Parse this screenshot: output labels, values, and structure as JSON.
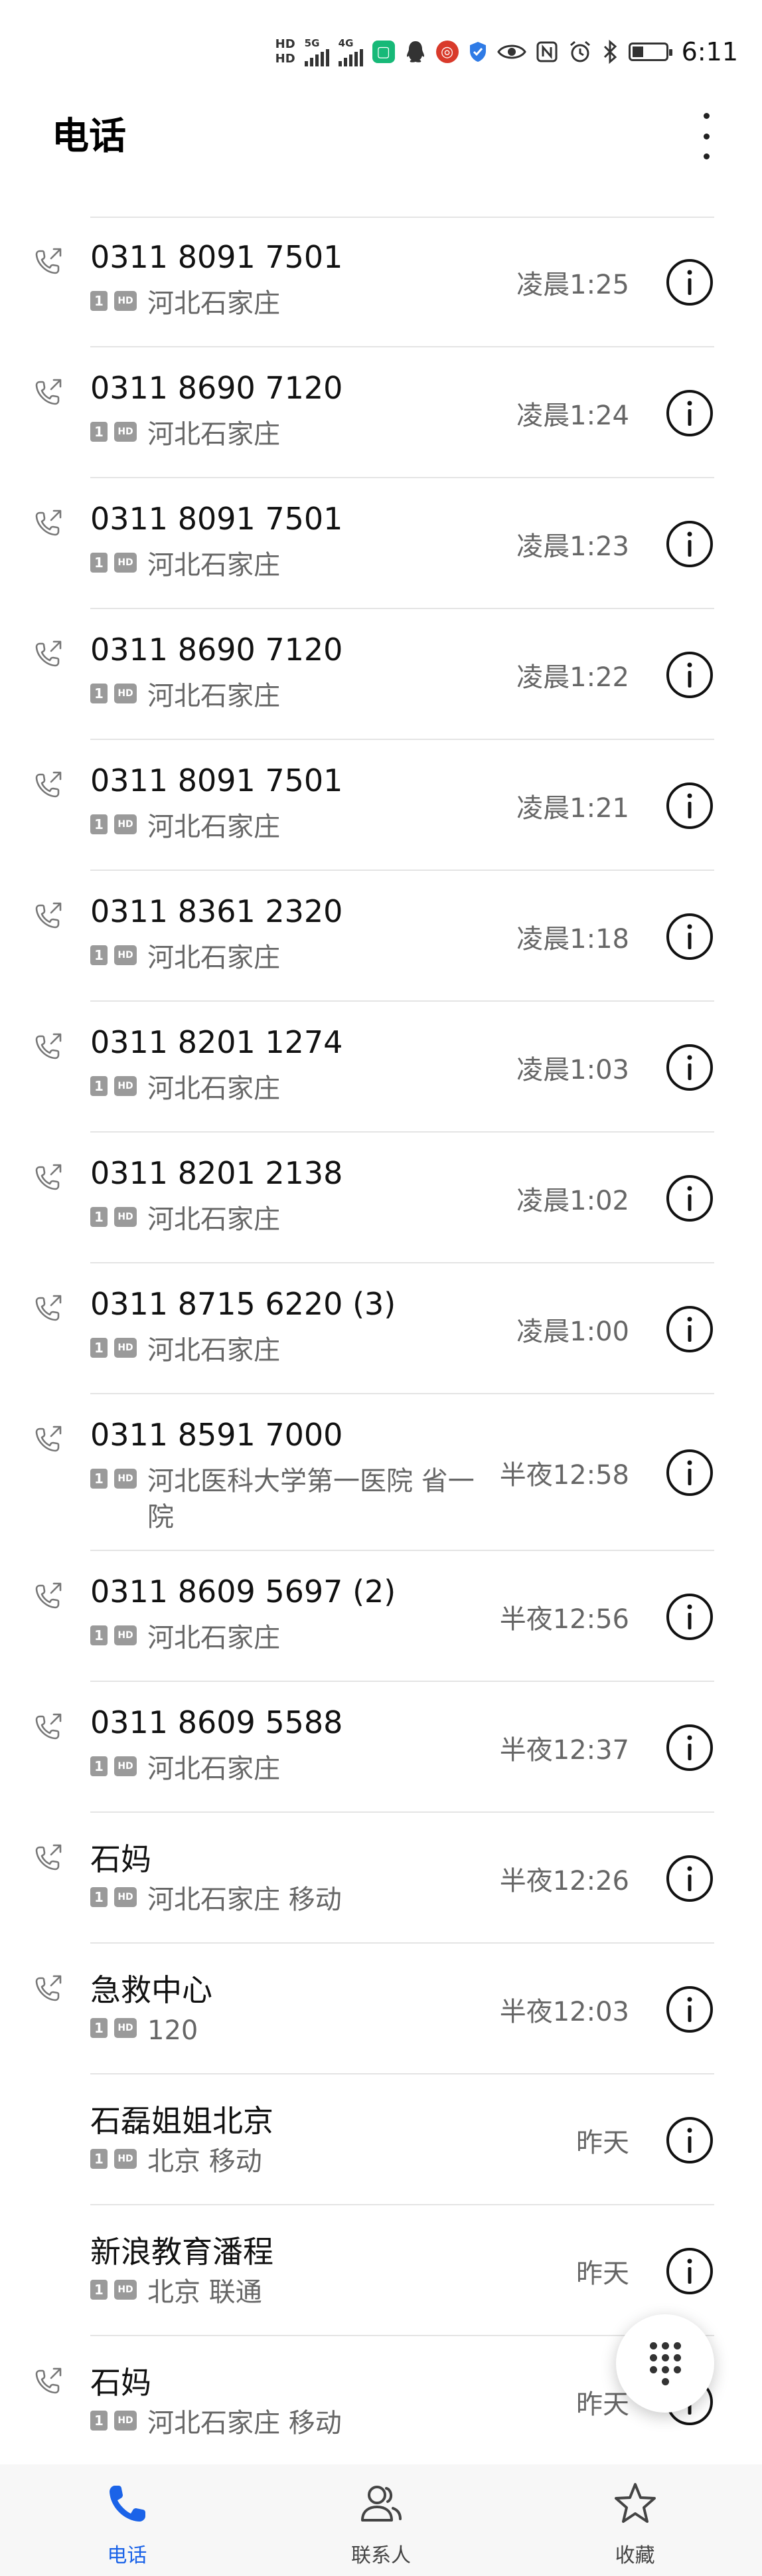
{
  "status_bar": {
    "hd_top": "HD",
    "hd_bottom": "HD",
    "net1": "5G",
    "net2": "4G",
    "time": "6:11",
    "icons": [
      "signal-icon",
      "signal-icon",
      "app-notification-icon",
      "qq-icon",
      "app-notification-icon",
      "shield-icon",
      "eye-icon",
      "nfc-icon",
      "alarm-icon",
      "bluetooth-icon",
      "battery-icon"
    ]
  },
  "header": {
    "title": "电话",
    "more_icon": "more-vertical-icon"
  },
  "colors": {
    "accent": "#1b63e8",
    "text_primary": "#111111",
    "text_secondary": "#666666",
    "divider": "#e4e4e4",
    "badge": "#9a9a9a"
  },
  "badges": {
    "sim": "1",
    "hd": "HD"
  },
  "calls": [
    {
      "name": "0311 8091 7501",
      "location": "河北石家庄",
      "time": "凌晨1:25",
      "type": "outgoing"
    },
    {
      "name": "0311 8690 7120",
      "location": "河北石家庄",
      "time": "凌晨1:24",
      "type": "outgoing"
    },
    {
      "name": "0311 8091 7501",
      "location": "河北石家庄",
      "time": "凌晨1:23",
      "type": "outgoing"
    },
    {
      "name": "0311 8690 7120",
      "location": "河北石家庄",
      "time": "凌晨1:22",
      "type": "outgoing"
    },
    {
      "name": "0311 8091 7501",
      "location": "河北石家庄",
      "time": "凌晨1:21",
      "type": "outgoing"
    },
    {
      "name": "0311 8361 2320",
      "location": "河北石家庄",
      "time": "凌晨1:18",
      "type": "outgoing"
    },
    {
      "name": "0311 8201 1274",
      "location": "河北石家庄",
      "time": "凌晨1:03",
      "type": "outgoing"
    },
    {
      "name": "0311 8201 2138",
      "location": "河北石家庄",
      "time": "凌晨1:02",
      "type": "outgoing"
    },
    {
      "name": "0311 8715 6220 (3)",
      "location": "河北石家庄",
      "time": "凌晨1:00",
      "type": "outgoing"
    },
    {
      "name": "0311 8591 7000",
      "location": "河北医科大学第一医院 省一院",
      "time": "半夜12:58",
      "type": "outgoing"
    },
    {
      "name": "0311 8609 5697 (2)",
      "location": "河北石家庄",
      "time": "半夜12:56",
      "type": "outgoing"
    },
    {
      "name": "0311 8609 5588",
      "location": "河北石家庄",
      "time": "半夜12:37",
      "type": "outgoing"
    },
    {
      "name": "石妈",
      "location": "河北石家庄 移动",
      "time": "半夜12:26",
      "type": "outgoing"
    },
    {
      "name": "急救中心",
      "location": "120",
      "time": "半夜12:03",
      "type": "outgoing"
    },
    {
      "name": "石磊姐姐北京",
      "location": "北京 移动",
      "time": "昨天",
      "type": "none"
    },
    {
      "name": "新浪教育潘程",
      "location": "北京 联通",
      "time": "昨天",
      "type": "none"
    },
    {
      "name": "石妈",
      "location": "河北石家庄 移动",
      "time": "昨天",
      "type": "outgoing"
    }
  ],
  "fab": {
    "icon": "dialpad-icon"
  },
  "bottom_nav": [
    {
      "label": "电话",
      "icon": "phone-icon",
      "active": true
    },
    {
      "label": "联系人",
      "icon": "contacts-icon",
      "active": false
    },
    {
      "label": "收藏",
      "icon": "star-icon",
      "active": false
    }
  ]
}
